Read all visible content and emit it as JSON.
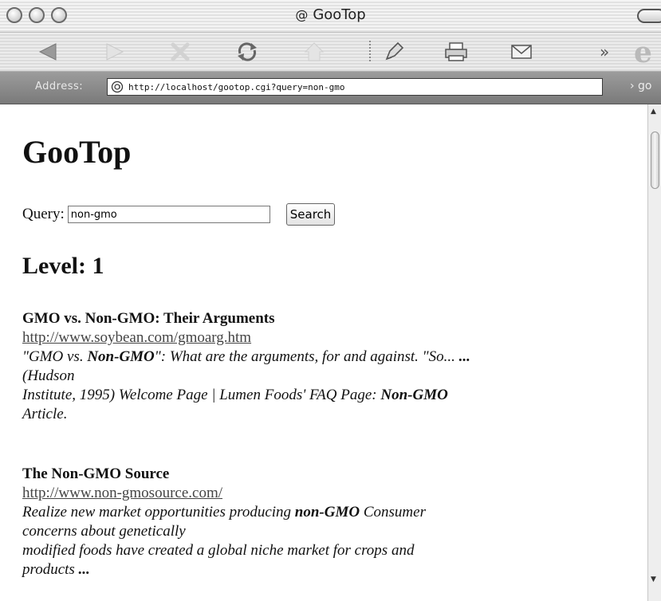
{
  "window": {
    "title": "GooTop",
    "site_icon": "@"
  },
  "toolbar": {
    "items": [
      "back-icon",
      "forward-icon",
      "stop-icon",
      "refresh-icon",
      "home-icon",
      "autofill-icon",
      "print-icon",
      "mail-icon"
    ],
    "overflow": "»",
    "browser_logo": "e"
  },
  "address": {
    "label": "Address:",
    "url": "http://localhost/gootop.cgi?query=non-gmo",
    "go_label": "› go"
  },
  "page": {
    "title": "GooTop",
    "query_label": "Query:",
    "query_value": "non-gmo",
    "search_button": "Search",
    "level": "Level: 1"
  },
  "results": [
    {
      "title": "GMO vs. Non-GMO: Their Arguments",
      "url": "http://www.soybean.com/gmoarg.htm",
      "snippet": [
        {
          "t": "\"GMO vs. ",
          "b": false
        },
        {
          "t": "Non-GMO",
          "b": true
        },
        {
          "t": "\": What are the arguments, for and against. \"So... ",
          "b": false
        },
        {
          "t": "...",
          "b": true
        },
        {
          "t": "\n(Hudson\nInstitute, 1995) Welcome Page | Lumen Foods' FAQ Page: ",
          "b": false
        },
        {
          "t": "Non-GMO",
          "b": true
        },
        {
          "t": "\nArticle.",
          "b": false
        }
      ]
    },
    {
      "title": "The Non-GMO Source",
      "url": "http://www.non-gmosource.com/",
      "snippet": [
        {
          "t": "Realize new market opportunities producing ",
          "b": false
        },
        {
          "t": "non-GMO",
          "b": true
        },
        {
          "t": " Consumer\nconcerns about genetically\nmodified foods have created a global niche market for crops and\nproducts ",
          "b": false
        },
        {
          "t": "...",
          "b": true
        }
      ]
    }
  ],
  "scrollbar": {
    "up": "▲",
    "down": "▼"
  }
}
